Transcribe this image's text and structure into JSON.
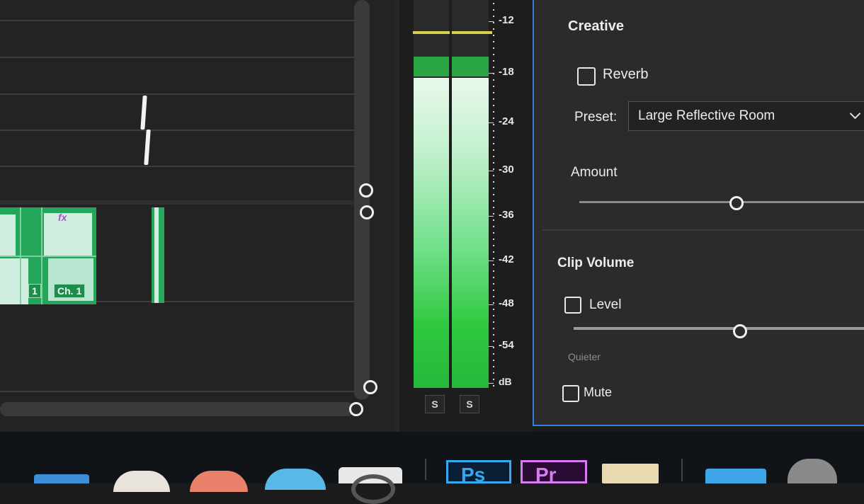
{
  "timeline": {
    "clip_labels": [
      "1",
      "Ch. 1"
    ],
    "fx_badge": "fx"
  },
  "meter": {
    "scale": [
      "-12",
      "-18",
      "-24",
      "-30",
      "-36",
      "-42",
      "-48",
      "-54",
      "dB"
    ],
    "solo_buttons": [
      "S",
      "S"
    ],
    "fill_color": "#2fc940",
    "peak_color": "#d7d34a"
  },
  "panel": {
    "creative_title": "Creative",
    "reverb_label": "Reverb",
    "preset_label": "Preset:",
    "preset_value": "Large Reflective Room",
    "amount_label": "Amount",
    "clip_volume_title": "Clip Volume",
    "level_label": "Level",
    "quieter_label": "Quieter",
    "mute_label": "Mute",
    "accent_color": "#2f7fd8"
  },
  "dock": {
    "ps_label": "Ps",
    "pr_label": "Pr"
  }
}
